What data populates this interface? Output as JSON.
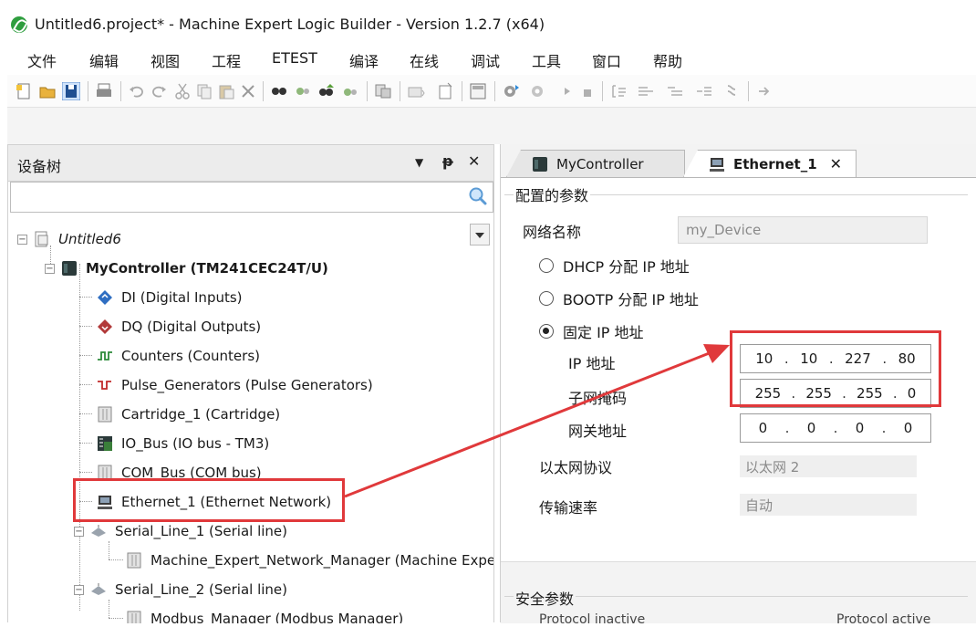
{
  "window": {
    "title": "Untitled6.project* - Machine Expert Logic Builder - Version 1.2.7 (x64)"
  },
  "menu": [
    "文件",
    "编辑",
    "视图",
    "工程",
    "ETEST",
    "编译",
    "在线",
    "调试",
    "工具",
    "窗口",
    "帮助"
  ],
  "toolbar_icons": [
    "new-project-icon",
    "open-folder-icon",
    "save-icon",
    "print-icon",
    "undo-icon",
    "redo-icon",
    "cut-icon",
    "copy-icon",
    "paste-icon",
    "delete-icon",
    "find-icon",
    "find-replace-icon",
    "find-next-icon",
    "find-prev-icon",
    "manage-icon",
    "device-add-icon",
    "object-add-icon",
    "calculator-icon",
    "login-icon",
    "logout-icon",
    "run-icon",
    "stop-icon",
    "breakpoint-icon",
    "step-over-icon",
    "step-into-icon",
    "step-out-icon",
    "debug-icon",
    "jump-icon"
  ],
  "device_tree": {
    "title": "设备树",
    "search_placeholder": "",
    "root": "Untitled6",
    "items": [
      {
        "label": "MyController (TM241CEC24T/U)",
        "icon": "controller-icon"
      },
      {
        "label": "DI (Digital Inputs)",
        "icon": "digital-inputs-icon"
      },
      {
        "label": "DQ (Digital Outputs)",
        "icon": "digital-outputs-icon"
      },
      {
        "label": "Counters (Counters)",
        "icon": "counters-icon"
      },
      {
        "label": "Pulse_Generators (Pulse Generators)",
        "icon": "pulse-generators-icon"
      },
      {
        "label": "Cartridge_1 (Cartridge)",
        "icon": "cartridge-icon"
      },
      {
        "label": "IO_Bus (IO bus - TM3)",
        "icon": "io-bus-icon"
      },
      {
        "label": "COM_Bus (COM bus)",
        "icon": "com-bus-icon"
      },
      {
        "label": "Ethernet_1 (Ethernet Network)",
        "icon": "ethernet-icon"
      },
      {
        "label": "Serial_Line_1 (Serial line)",
        "icon": "serial-line-icon"
      },
      {
        "label": "Machine_Expert_Network_Manager (Machine Exper",
        "icon": "network-manager-icon"
      },
      {
        "label": "Serial_Line_2 (Serial line)",
        "icon": "serial-line-icon"
      },
      {
        "label": "Modbus_Manager (Modbus Manager)",
        "icon": "modbus-manager-icon"
      }
    ]
  },
  "tabs": {
    "inactive": "MyController",
    "active": "Ethernet_1"
  },
  "config": {
    "group_title": "配置的参数",
    "network_name_label": "网络名称",
    "network_name_value": "my_Device",
    "dhcp_label": "DHCP 分配 IP 地址",
    "bootp_label": "BOOTP 分配 IP 地址",
    "fixed_label": "固定 IP 地址",
    "ip_label": "IP 地址",
    "subnet_label": "子网掩码",
    "gateway_label": "网关地址",
    "ip": [
      "10",
      "10",
      "227",
      "80"
    ],
    "subnet": [
      "255",
      "255",
      "255",
      "0"
    ],
    "gateway": [
      "0",
      "0",
      "0",
      "0"
    ],
    "protocol_label": "以太网协议",
    "protocol_value": "以太网 2",
    "speed_label": "传输速率",
    "speed_value": "自动"
  },
  "security": {
    "group_title": "安全参数",
    "col_inactive": "Protocol inactive",
    "col_active": "Protocol active"
  },
  "annotation_color": "#e0393b"
}
